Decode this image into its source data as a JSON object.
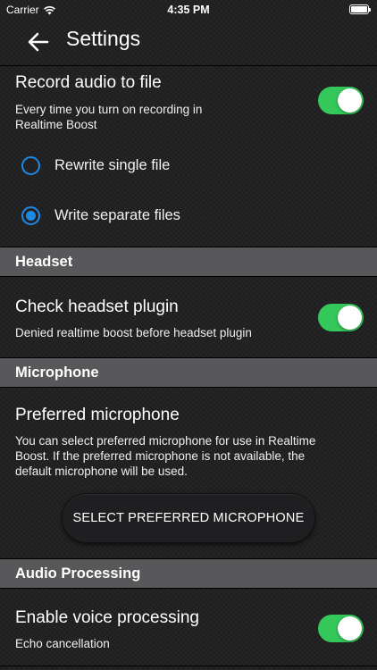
{
  "status_bar": {
    "carrier": "Carrier",
    "time": "4:35 PM"
  },
  "nav": {
    "title": "Settings"
  },
  "record": {
    "title": "Record audio to file",
    "subtitle_line1": "Every time you turn on recording in",
    "subtitle_line2": "Realtime Boost",
    "enabled": true,
    "options": [
      {
        "label": "Rewrite single file",
        "selected": false
      },
      {
        "label": "Write separate files",
        "selected": true
      }
    ]
  },
  "headset": {
    "header": "Headset",
    "title": "Check headset plugin",
    "subtitle": "Denied realtime boost before headset plugin",
    "enabled": true
  },
  "microphone": {
    "header": "Microphone",
    "title": "Preferred microphone",
    "desc_line1": "You can select preferred microphone for use in Realtime",
    "desc_line2": "Boost. If the preferred microphone is not available, the",
    "desc_line3": "default microphone will be used.",
    "button_label": "SELECT PREFERRED MICROPHONE"
  },
  "audio_processing": {
    "header": "Audio Processing",
    "title": "Enable voice processing",
    "subtitle": "Echo cancellation",
    "enabled": true
  },
  "colors": {
    "toggle_on": "#34c759",
    "radio": "#1e88e5",
    "section_header": "#58585a"
  }
}
